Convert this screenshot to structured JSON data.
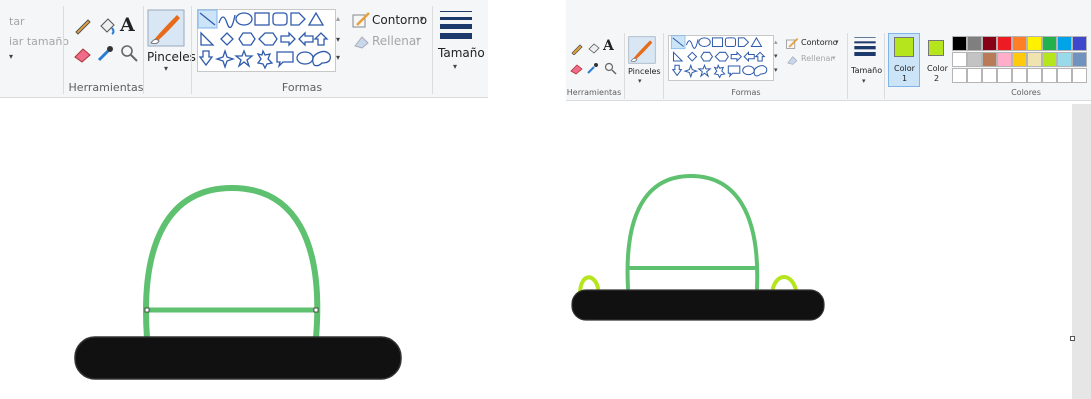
{
  "left": {
    "partial_labels": {
      "line1": "tar",
      "line2": "iar tamaño"
    },
    "groups": {
      "tools": "Herramientas",
      "shapes": "Formas"
    },
    "brushes_label": "Pinceles",
    "outline_label": "Contorno",
    "fill_label": "Rellenar",
    "size_label": "Tamaño"
  },
  "right": {
    "groups": {
      "tools": "Herramientas",
      "shapes": "Formas",
      "colors": "Colores"
    },
    "brushes_label": "Pinceles",
    "outline_label": "Contorno",
    "fill_label": "Rellenar",
    "size_label": "Tamaño",
    "color1_label": "Color",
    "color1_num": "1",
    "color2_label": "Color",
    "color2_num": "2",
    "palette_row1": [
      "#000000",
      "#7f7f7f",
      "#880015",
      "#ed1c24",
      "#ff7f27",
      "#fff200",
      "#22b14c",
      "#00a2e8",
      "#3f48cc"
    ],
    "palette_row2": [
      "#ffffff",
      "#c3c3c3",
      "#b97a57",
      "#ffaec9",
      "#ffc90e",
      "#efe4b0",
      "#b5e61d",
      "#99d9ea",
      "#7092be"
    ]
  },
  "colors": {
    "hat_green": "#5ec16f",
    "active_color": "#b5e61d",
    "brim": "#111111",
    "ribbon_bg": "#f5f6f7",
    "selection_blue": "#cce4f7"
  }
}
